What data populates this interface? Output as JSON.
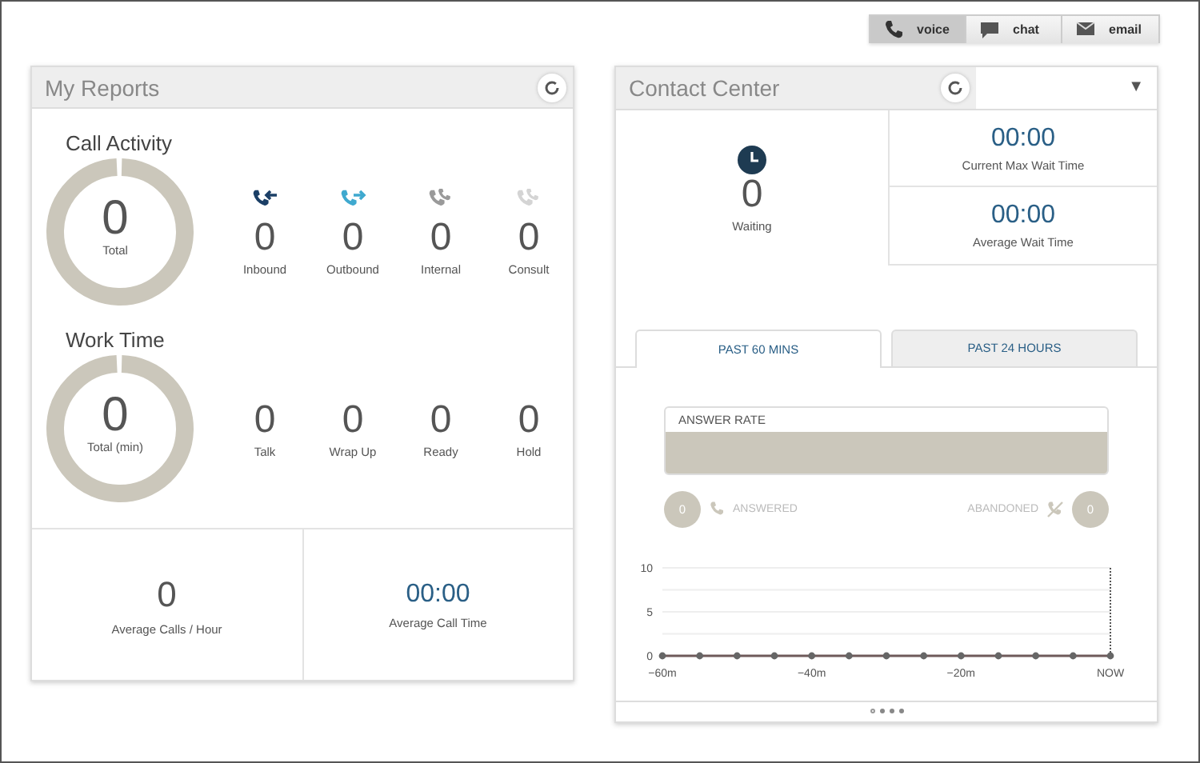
{
  "channel_tabs": [
    {
      "label": "voice",
      "kind": "phone",
      "selected": true
    },
    {
      "label": "chat",
      "kind": "chat",
      "selected": false
    },
    {
      "label": "email",
      "kind": "mail",
      "selected": false
    }
  ],
  "my_reports": {
    "title": "My Reports",
    "call_activity": {
      "title": "Call Activity",
      "total": {
        "value": "0",
        "label": "Total"
      },
      "stats": [
        {
          "value": "0",
          "label": "Inbound",
          "kind": "incoming",
          "color": "#1b3f66"
        },
        {
          "value": "0",
          "label": "Outbound",
          "kind": "outgoing",
          "color": "#3fa9cf"
        },
        {
          "value": "0",
          "label": "Internal",
          "kind": "pair",
          "color": "#9a9a9a"
        },
        {
          "value": "0",
          "label": "Consult",
          "kind": "pair",
          "color": "#d4d4d4"
        }
      ]
    },
    "work_time": {
      "title": "Work Time",
      "total": {
        "value": "0",
        "label": "Total (min)"
      },
      "stats": [
        {
          "value": "0",
          "label": "Talk"
        },
        {
          "value": "0",
          "label": "Wrap Up"
        },
        {
          "value": "0",
          "label": "Ready"
        },
        {
          "value": "0",
          "label": "Hold"
        }
      ]
    },
    "summary": [
      {
        "value": "0",
        "label": "Average Calls / Hour",
        "kind": "count"
      },
      {
        "value": "00:00",
        "label": "Average Call Time",
        "kind": "time"
      }
    ]
  },
  "contact_center": {
    "title": "Contact Center",
    "menu_glyph": "▼",
    "waiting": {
      "value": "0",
      "label": "Waiting"
    },
    "times": [
      {
        "value": "00:00",
        "label": "Current Max Wait Time"
      },
      {
        "value": "00:00",
        "label": "Average Wait Time"
      }
    ],
    "tabs": [
      {
        "label": "PAST 60 MINS",
        "selected": true
      },
      {
        "label": "PAST 24 HOURS",
        "selected": false
      }
    ],
    "answer_rate": {
      "title": "ANSWER RATE"
    },
    "answered": {
      "count": "0",
      "label": "ANSWERED"
    },
    "abandoned": {
      "count": "0",
      "label": "ABANDONED"
    },
    "chart_data": {
      "type": "line",
      "x": [
        -60,
        -55,
        -50,
        -45,
        -40,
        -35,
        -30,
        -25,
        -20,
        -15,
        -10,
        -5,
        0
      ],
      "series": [
        {
          "color": "#6e5a5a",
          "marker": "circle",
          "values": [
            0,
            0,
            0,
            0,
            0,
            0,
            0,
            0,
            0,
            0,
            0,
            0,
            0
          ]
        }
      ],
      "xlim": [
        -60,
        0
      ],
      "ylim": [
        0,
        10
      ],
      "xticks": [
        {
          "value": -60,
          "label": "−60m"
        },
        {
          "value": -40,
          "label": "−40m"
        },
        {
          "value": -20,
          "label": "−20m"
        },
        {
          "value": 0,
          "label": "NOW"
        }
      ],
      "yticks": [
        0,
        5,
        10
      ]
    },
    "pages": [
      {
        "selected": true
      },
      {
        "selected": false
      },
      {
        "selected": false
      },
      {
        "selected": false
      }
    ]
  }
}
